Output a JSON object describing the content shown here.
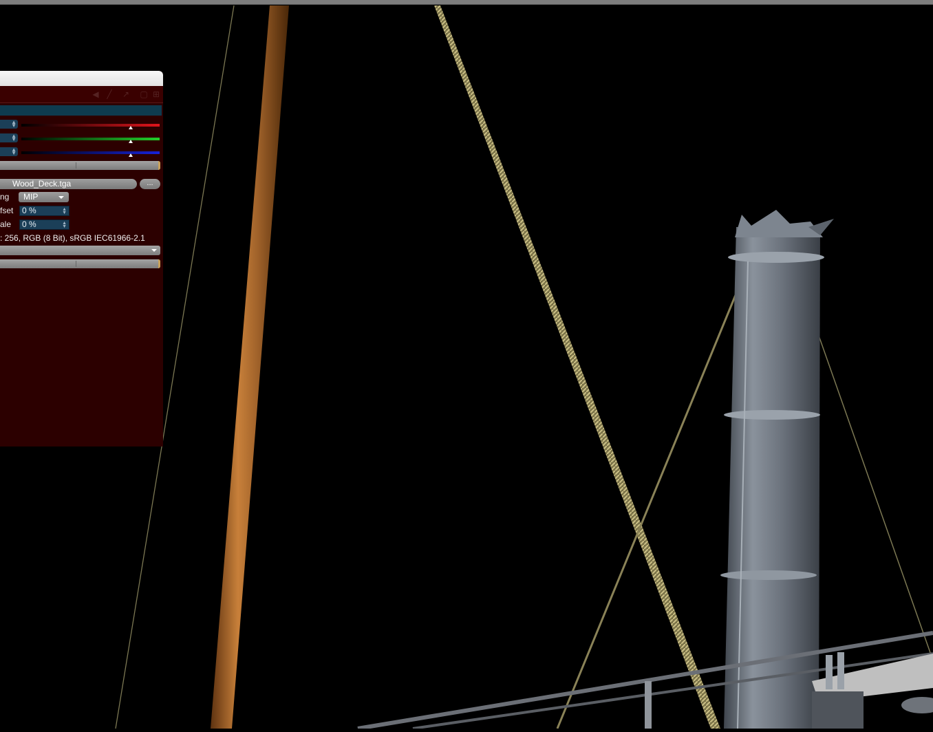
{
  "panel": {
    "filename": "Wood_Deck.tga",
    "browse_label": "...",
    "filtering_label": "ng",
    "filtering_value": "MIP",
    "offset_label": "fset",
    "offset_value": "0 %",
    "scale_label": "ale",
    "scale_value": "0 %",
    "image_info": ": 256, RGB (8 Bit), sRGB IEC61966-2.1",
    "swatch_color": "#0e3b4f",
    "channels": [
      {
        "name": "red",
        "color": "#e0141b",
        "level": 0.79
      },
      {
        "name": "green",
        "color": "#23d02b",
        "level": 0.79
      },
      {
        "name": "blue",
        "color": "#1622d8",
        "level": 0.79
      }
    ]
  },
  "toolbar_icons": [
    "back-arrow-icon",
    "pen-icon",
    "cursor-icon",
    "lock-icon",
    "expand-icon"
  ],
  "scene_colors": {
    "background": "#000000",
    "panel_bg": "#2c0000",
    "funnel": "#6f7680",
    "mast": "#9a5a22",
    "rope": "#a59a66"
  }
}
